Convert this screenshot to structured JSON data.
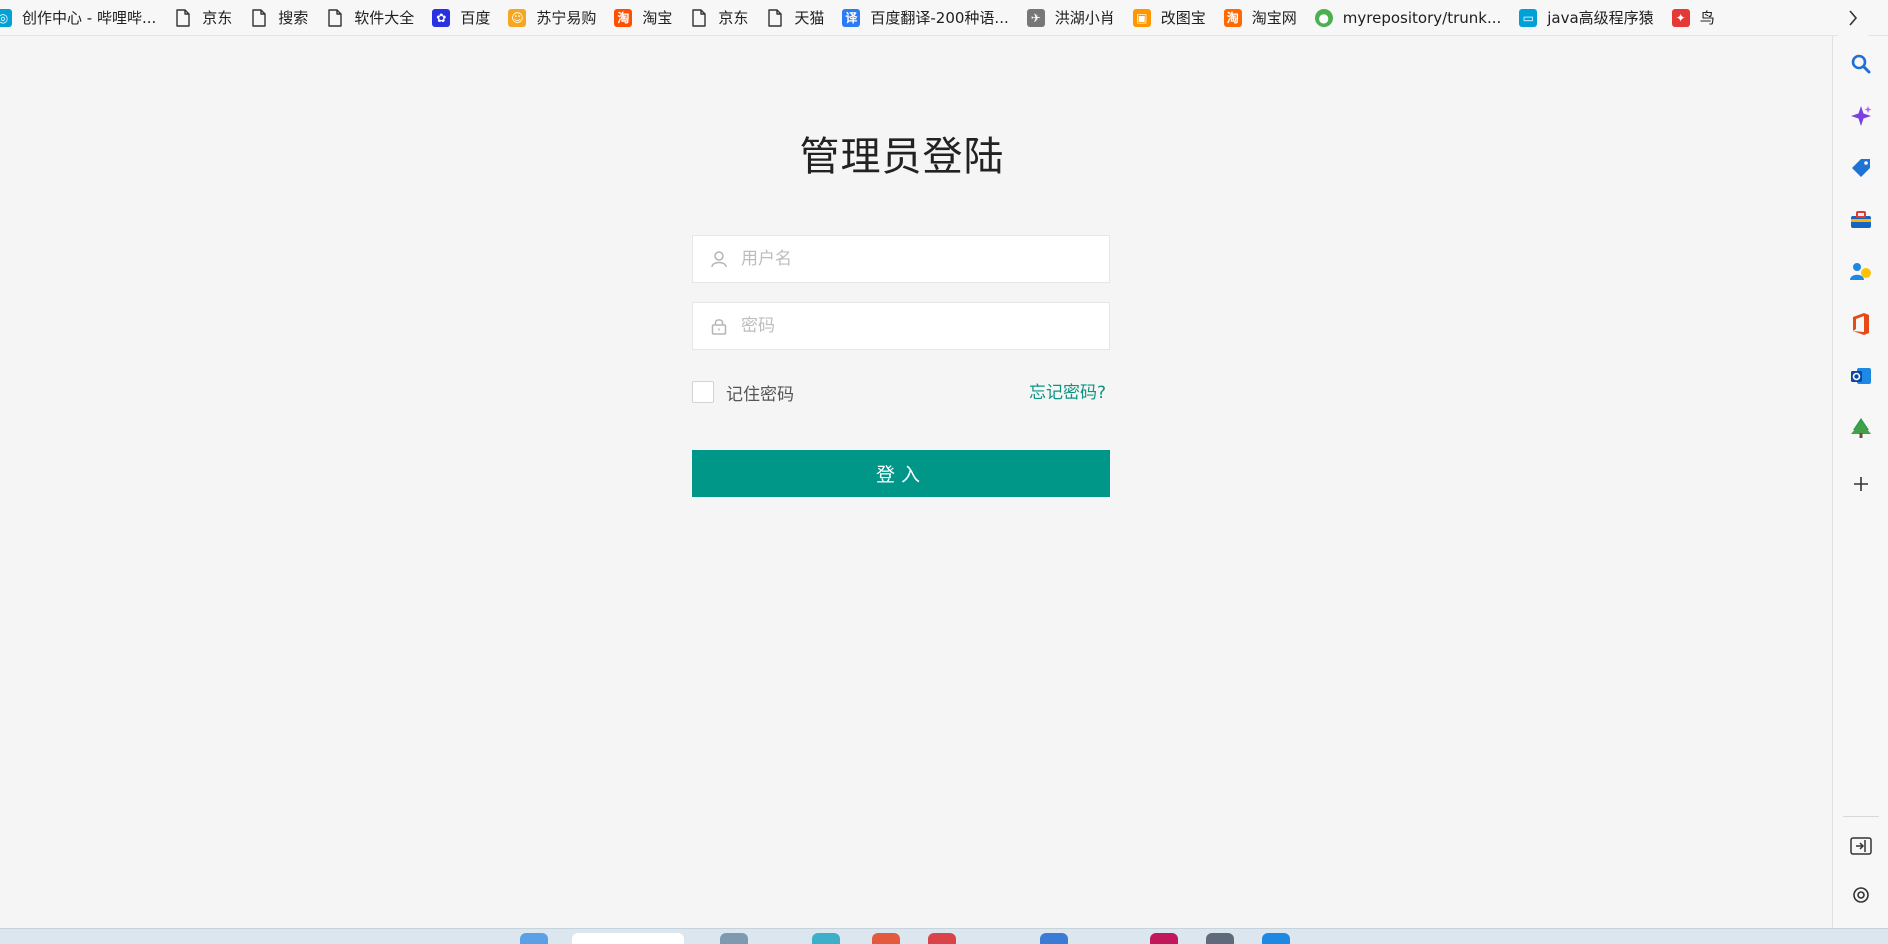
{
  "bookmarks": [
    {
      "label": "创作中心 - 哔哩哔...",
      "icon": "bilibili-creator-icon",
      "color": "#00a1d6"
    },
    {
      "label": "京东",
      "icon": "page-icon",
      "color": ""
    },
    {
      "label": "搜索",
      "icon": "page-icon",
      "color": ""
    },
    {
      "label": "软件大全",
      "icon": "page-icon",
      "color": ""
    },
    {
      "label": "百度",
      "icon": "baidu-paw-icon",
      "color": "#2932e1"
    },
    {
      "label": "苏宁易购",
      "icon": "suning-lion-icon",
      "color": "#f5a623"
    },
    {
      "label": "淘宝",
      "icon": "taobao-icon",
      "color": "#ff5000"
    },
    {
      "label": "京东",
      "icon": "page-icon",
      "color": ""
    },
    {
      "label": "天猫",
      "icon": "page-icon",
      "color": ""
    },
    {
      "label": "百度翻译-200种语...",
      "icon": "baidu-translate-icon",
      "color": "#2a7bf6"
    },
    {
      "label": "洪湖小肖",
      "icon": "bird-mascot-icon",
      "color": "#777777"
    },
    {
      "label": "改图宝",
      "icon": "gaitubao-icon",
      "color": "#ff9800"
    },
    {
      "label": "淘宝网",
      "icon": "taobao-icon",
      "color": "#ff6a00"
    },
    {
      "label": "myrepository/trunk...",
      "icon": "chrome-like-icon",
      "color": "#4caf50"
    },
    {
      "label": "java高级程序猿",
      "icon": "bilibili-tv-icon",
      "color": "#00a1d6"
    },
    {
      "label": "鸟",
      "icon": "bird-icon",
      "color": "#e53935"
    }
  ],
  "login": {
    "title": "管理员登陆",
    "username_placeholder": "用户名",
    "password_placeholder": "密码",
    "remember_label": "记住密码",
    "forgot_label": "忘记密码?",
    "submit_label": "登入"
  },
  "sidebar": [
    {
      "name": "search-icon"
    },
    {
      "name": "copilot-sparkle-icon"
    },
    {
      "name": "shopping-tag-icon"
    },
    {
      "name": "toolbox-icon"
    },
    {
      "name": "people-games-icon"
    },
    {
      "name": "office-icon"
    },
    {
      "name": "outlook-icon"
    },
    {
      "name": "tree-icon"
    },
    {
      "name": "add-icon"
    },
    {
      "name": "split-screen-icon"
    },
    {
      "name": "settings-icon"
    }
  ],
  "colors": {
    "accent": "#009688",
    "link": "#0a9582",
    "page_bg": "#f5f5f5"
  }
}
